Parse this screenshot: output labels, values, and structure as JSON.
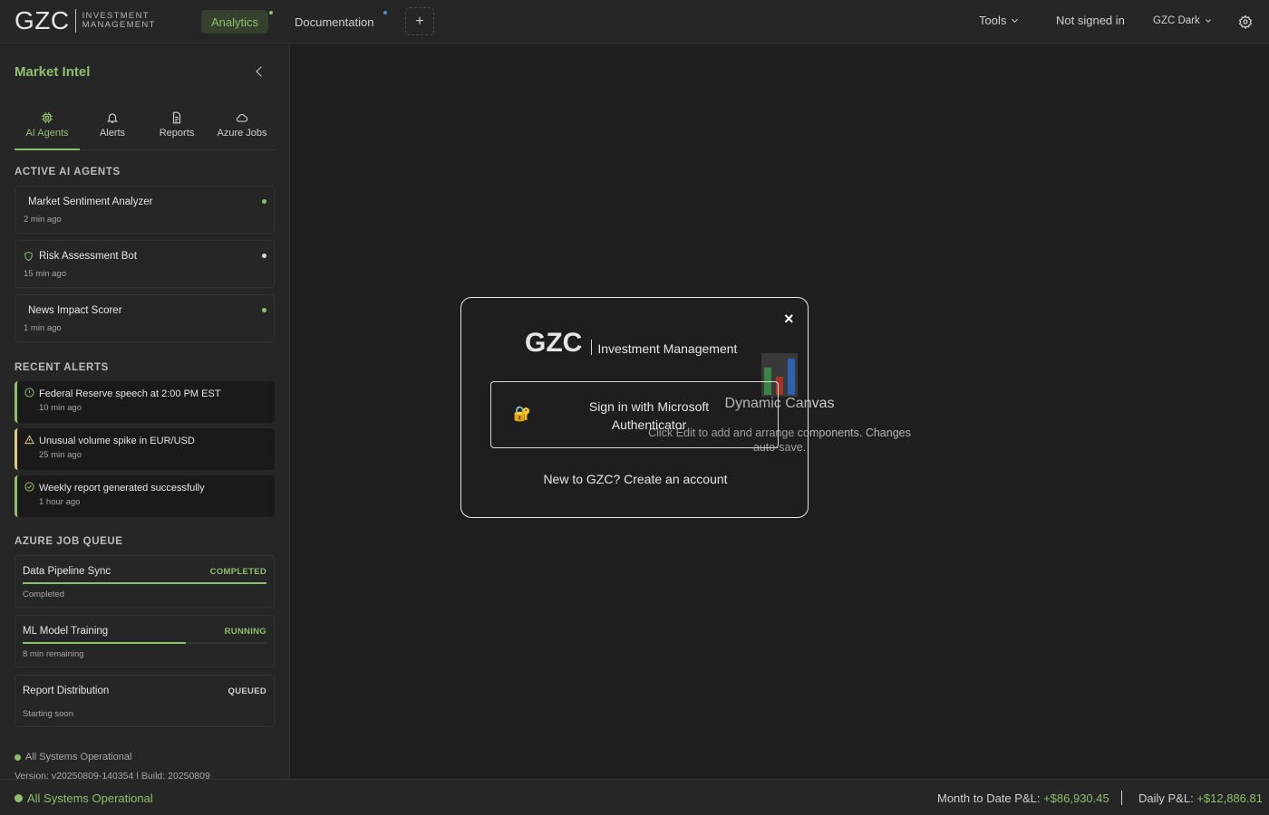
{
  "header": {
    "logo": {
      "mark": "GZC",
      "line1": "INVESTMENT",
      "line2": "MANAGEMENT"
    },
    "tabs": [
      {
        "label": "Analytics",
        "active": true,
        "indicator_color": "#8fbf6a"
      },
      {
        "label": "Documentation",
        "active": false,
        "indicator_color": "#4a90d9"
      }
    ],
    "add_tab_symbol": "+",
    "tools_label": "Tools",
    "user_status": "Not signed in",
    "theme_label": "GZC Dark",
    "settings_icon": "gear-icon"
  },
  "sidebar": {
    "title": "Market Intel",
    "tabs": [
      {
        "label": "AI Agents",
        "icon": "chip-icon",
        "active": true
      },
      {
        "label": "Alerts",
        "icon": "bell-icon",
        "active": false
      },
      {
        "label": "Reports",
        "icon": "document-icon",
        "active": false
      },
      {
        "label": "Azure Jobs",
        "icon": "cloud-icon",
        "active": false
      }
    ],
    "agents_heading": "ACTIVE AI AGENTS",
    "agents": [
      {
        "name": "Market Sentiment Analyzer",
        "time": "2 min ago",
        "status_color": "#8fbf6a"
      },
      {
        "name": "Risk Assessment Bot",
        "time": "15 min ago",
        "status_color": "#d9d9d9",
        "icon": "shield-icon"
      },
      {
        "name": "News Impact Scorer",
        "time": "1 min ago",
        "status_color": "#8fbf6a"
      }
    ],
    "alerts_heading": "RECENT ALERTS",
    "alerts": [
      {
        "text": "Federal Reserve speech at 2:00 PM EST",
        "time": "10 min ago",
        "icon": "info-icon",
        "accent": "#8fbf6a"
      },
      {
        "text": "Unusual volume spike in EUR/USD",
        "time": "25 min ago",
        "icon": "warning-icon",
        "accent": "#e0c77a"
      },
      {
        "text": "Weekly report generated successfully",
        "time": "1 hour ago",
        "icon": "check-circle-icon",
        "accent": "#8fbf6a"
      }
    ],
    "jobs_heading": "AZURE JOB QUEUE",
    "jobs": [
      {
        "name": "Data Pipeline Sync",
        "status": "COMPLETED",
        "status_color": "#8fbf6a",
        "progress": 1.0,
        "detail": "Completed"
      },
      {
        "name": "ML Model Training",
        "status": "RUNNING",
        "status_color": "#8fbf6a",
        "progress": 0.67,
        "detail": "8 min remaining"
      },
      {
        "name": "Report Distribution",
        "status": "QUEUED",
        "status_color": "#cfcfcf",
        "progress": 0,
        "detail": "Starting soon"
      }
    ],
    "system_status": "All Systems Operational",
    "version": "Version: v20250809-140354 | Build: 20250809"
  },
  "canvas": {
    "title": "Dynamic Canvas",
    "description": "Click Edit to add and arrange components. Changes auto-save.",
    "icon": "bar-chart-icon"
  },
  "modal": {
    "logo_mark": "GZC",
    "logo_text": "Investment Management",
    "close_symbol": "×",
    "ms_button_icon": "lock-icon",
    "ms_button_label": "Sign in with Microsoft Authenticator",
    "create_account": "New to GZC? Create an account"
  },
  "footer": {
    "status": "All Systems Operational",
    "mtd_label": "Month to Date P&L:",
    "mtd_value": "+$86,930.45",
    "daily_label": "Daily P&L:",
    "daily_value": "+$12,886.81"
  }
}
